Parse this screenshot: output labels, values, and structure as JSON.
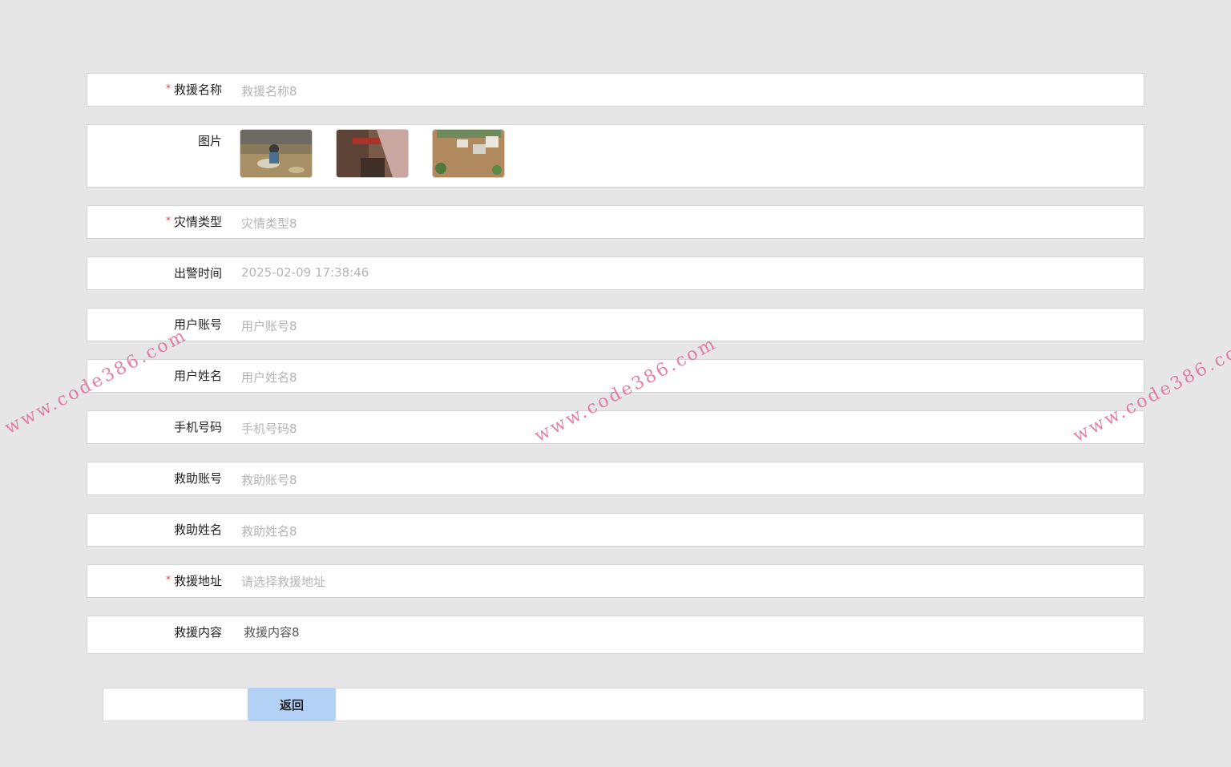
{
  "form": {
    "fields": [
      {
        "label": "救援名称",
        "required": true,
        "value": "救援名称8"
      },
      {
        "label": "图片",
        "required": false,
        "images": [
          "rescue-photo-1",
          "rescue-photo-2",
          "rescue-photo-3"
        ]
      },
      {
        "label": "灾情类型",
        "required": true,
        "value": "灾情类型8"
      },
      {
        "label": "出警时间",
        "required": false,
        "value": "2025-02-09 17:38:46"
      },
      {
        "label": "用户账号",
        "required": false,
        "value": "用户账号8"
      },
      {
        "label": "用户姓名",
        "required": false,
        "value": "用户姓名8"
      },
      {
        "label": "手机号码",
        "required": false,
        "value": "手机号码8"
      },
      {
        "label": "救助账号",
        "required": false,
        "value": "救助账号8"
      },
      {
        "label": "救助姓名",
        "required": false,
        "value": "救助姓名8"
      },
      {
        "label": "救援地址",
        "required": true,
        "placeholder": "请选择救援地址"
      },
      {
        "label": "救援内容",
        "required": false,
        "value": "救援内容8"
      }
    ],
    "required_mark": "*",
    "back_button": "返回"
  },
  "watermark": "www.code386.com",
  "colors": {
    "background": "#e6e6e6",
    "required": "#e53935",
    "button": "#b3d1f5",
    "watermark": "#e0699a"
  }
}
